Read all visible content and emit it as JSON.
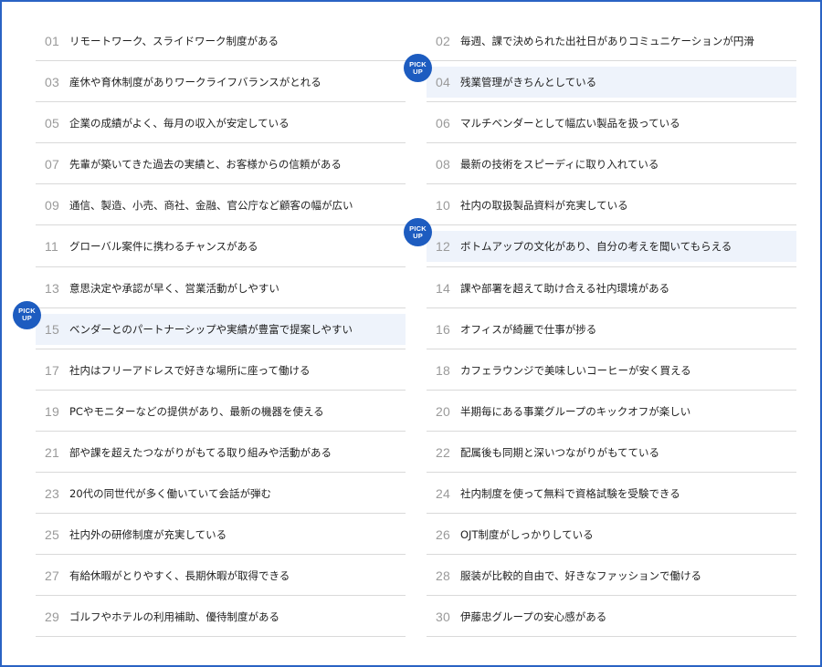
{
  "pick_label": [
    "PICK",
    "UP"
  ],
  "left_items": [
    {
      "num": "01",
      "text": "リモートワーク、スライドワーク制度がある",
      "pick": false
    },
    {
      "num": "03",
      "text": "産休や育休制度がありワークライフバランスがとれる",
      "pick": false
    },
    {
      "num": "05",
      "text": "企業の成績がよく、毎月の収入が安定している",
      "pick": false
    },
    {
      "num": "07",
      "text": "先輩が築いてきた過去の実績と、お客様からの信頼がある",
      "pick": false
    },
    {
      "num": "09",
      "text": "通信、製造、小売、商社、金融、官公庁など顧客の幅が広い",
      "pick": false
    },
    {
      "num": "11",
      "text": "グローバル案件に携わるチャンスがある",
      "pick": false
    },
    {
      "num": "13",
      "text": "意思決定や承認が早く、営業活動がしやすい",
      "pick": false
    },
    {
      "num": "15",
      "text": "ベンダーとのパートナーシップや実績が豊富で提案しやすい",
      "pick": true
    },
    {
      "num": "17",
      "text": "社内はフリーアドレスで好きな場所に座って働ける",
      "pick": false
    },
    {
      "num": "19",
      "text": "PCやモニターなどの提供があり、最新の機器を使える",
      "pick": false
    },
    {
      "num": "21",
      "text": "部や課を超えたつながりがもてる取り組みや活動がある",
      "pick": false
    },
    {
      "num": "23",
      "text": "20代の同世代が多く働いていて会話が弾む",
      "pick": false
    },
    {
      "num": "25",
      "text": "社内外の研修制度が充実している",
      "pick": false
    },
    {
      "num": "27",
      "text": "有給休暇がとりやすく、長期休暇が取得できる",
      "pick": false
    },
    {
      "num": "29",
      "text": "ゴルフやホテルの利用補助、優待制度がある",
      "pick": false
    }
  ],
  "right_items": [
    {
      "num": "02",
      "text": "毎週、課で決められた出社日がありコミュニケーションが円滑",
      "pick": false
    },
    {
      "num": "04",
      "text": "残業管理がきちんとしている",
      "pick": true
    },
    {
      "num": "06",
      "text": "マルチベンダーとして幅広い製品を扱っている",
      "pick": false
    },
    {
      "num": "08",
      "text": "最新の技術をスピーディに取り入れている",
      "pick": false
    },
    {
      "num": "10",
      "text": "社内の取扱製品資料が充実している",
      "pick": false
    },
    {
      "num": "12",
      "text": "ボトムアップの文化があり、自分の考えを聞いてもらえる",
      "pick": true
    },
    {
      "num": "14",
      "text": "課や部署を超えて助け合える社内環境がある",
      "pick": false
    },
    {
      "num": "16",
      "text": "オフィスが綺麗で仕事が捗る",
      "pick": false
    },
    {
      "num": "18",
      "text": "カフェラウンジで美味しいコーヒーが安く買える",
      "pick": false
    },
    {
      "num": "20",
      "text": "半期毎にある事業グループのキックオフが楽しい",
      "pick": false
    },
    {
      "num": "22",
      "text": "配属後も同期と深いつながりがもてている",
      "pick": false
    },
    {
      "num": "24",
      "text": "社内制度を使って無料で資格試験を受験できる",
      "pick": false
    },
    {
      "num": "26",
      "text": "OJT制度がしっかりしている",
      "pick": false
    },
    {
      "num": "28",
      "text": "服装が比較的自由で、好きなファッションで働ける",
      "pick": false
    },
    {
      "num": "30",
      "text": "伊藤忠グループの安心感がある",
      "pick": false
    }
  ],
  "colors": {
    "frame": "#2a63c4",
    "badge": "#1d5cc0",
    "highlight": "#eef3fb",
    "number": "#9a9a9a",
    "divider": "#d9d9d9"
  }
}
